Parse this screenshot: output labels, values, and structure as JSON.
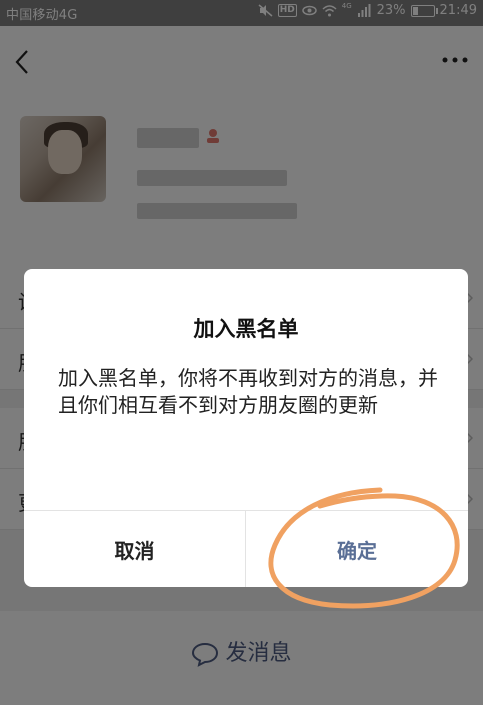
{
  "status_bar": {
    "carrier": "中国移动4G",
    "hd": "HD",
    "network": "4G",
    "battery": "23%",
    "battery_level": 0.23,
    "time": "21:49"
  },
  "nav": {
    "back_icon": "chevron-left-icon",
    "more_icon": "ellipsis-icon"
  },
  "row_letters": [
    "设",
    "朋",
    "朋",
    "更"
  ],
  "send_message": {
    "label": "发消息",
    "icon": "chat-bubble-icon"
  },
  "dialog": {
    "title": "加入黑名单",
    "message": "加入黑名单，你将不再收到对方的消息，并且你们相互看不到对方朋友圈的更新",
    "cancel_label": "取消",
    "confirm_label": "确定"
  },
  "colors": {
    "overlay": "rgba(0,0,0,0.5)",
    "confirm_text": "#5a6f96",
    "annotation_circle": "#f0a161",
    "gender_icon": "#e0796e"
  }
}
